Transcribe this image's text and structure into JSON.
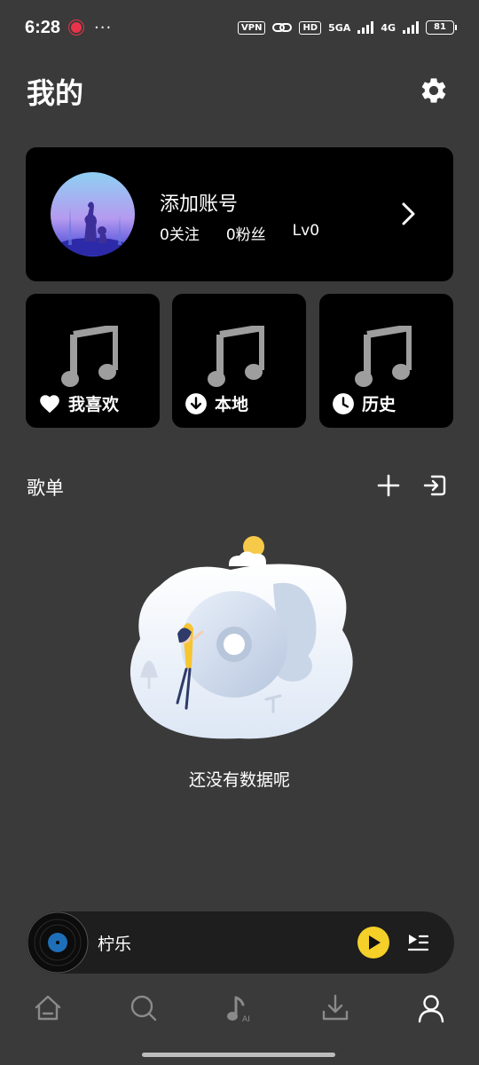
{
  "status_bar": {
    "time": "6:28",
    "more": "···",
    "vpn": "VPN",
    "hd": "HD",
    "net1": "5GA",
    "net2": "4G",
    "battery": "81"
  },
  "header": {
    "title": "我的"
  },
  "profile": {
    "name": "添加账号",
    "following": "0关注",
    "followers": "0粉丝",
    "level": "Lv0"
  },
  "quick_tiles": [
    {
      "label": "我喜欢",
      "icon": "heart-icon"
    },
    {
      "label": "本地",
      "icon": "download-icon"
    },
    {
      "label": "历史",
      "icon": "clock-icon"
    }
  ],
  "playlists": {
    "title": "歌单",
    "empty_text": "还没有数据呢"
  },
  "player": {
    "title": "柠乐"
  },
  "nav": {
    "items": [
      "home-icon",
      "search-icon",
      "ai-music-icon",
      "download-icon",
      "profile-icon"
    ]
  },
  "colors": {
    "background": "#3a3a3a",
    "card": "#000000",
    "accent": "#f4d028"
  }
}
